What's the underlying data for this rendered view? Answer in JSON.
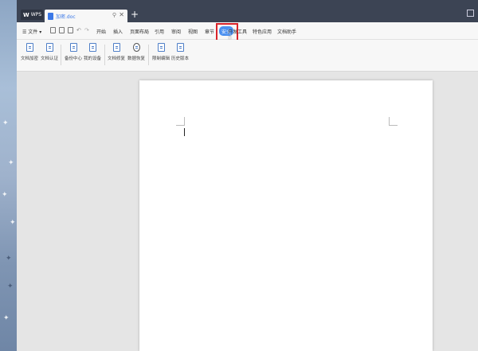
{
  "titlebar": {
    "app_tab": "WPS",
    "doc_tab": "加密.doc",
    "pin_glyph": "⚲",
    "close_glyph": "✕",
    "new_tab_glyph": "+"
  },
  "menubar": {
    "file_label": "☰ 文件 ▾",
    "items": [
      "开始",
      "插入",
      "页面布局",
      "引用",
      "审阅",
      "视图",
      "章节",
      "安全",
      "开发工具",
      "特色应用",
      "文档助手"
    ],
    "active_item": "安全"
  },
  "ribbon": {
    "buttons": [
      "文档加密",
      "文档认证",
      "备份中心",
      "我的设备",
      "文档修复",
      "数据恢复",
      "限制编辑",
      "历史版本"
    ]
  },
  "colors": {
    "highlight": "#d9232a",
    "active_tab": "#4a8ff0",
    "titlebar": "#3c4454"
  }
}
